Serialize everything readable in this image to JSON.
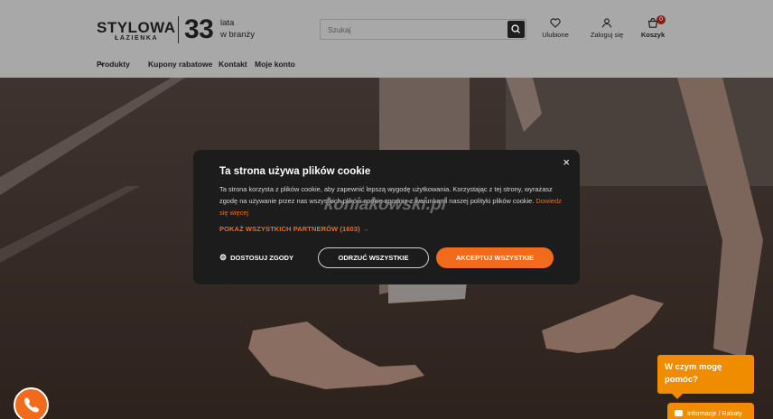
{
  "header": {
    "logo": {
      "brand": "STYLOWA",
      "sub": "ŁAZIENKA",
      "years": "33",
      "years_text_1": "lata",
      "years_text_2": "w branży"
    },
    "search": {
      "placeholder": "Szukaj",
      "icon": "search-icon"
    },
    "icons": {
      "favorites": {
        "label": "Ulubione",
        "icon": "heart-icon"
      },
      "login": {
        "label": "Zaloguj się",
        "icon": "user-icon"
      },
      "cart": {
        "label": "Koszyk",
        "icon": "cart-icon",
        "count": "0"
      }
    },
    "nav": [
      {
        "label": "Produkty",
        "has_dropdown": true
      },
      {
        "label": "Kupony rabatowe"
      },
      {
        "label": "Kontakt"
      },
      {
        "label": "Moje konto"
      }
    ]
  },
  "cookie_modal": {
    "title": "Ta strona używa plików cookie",
    "body": "Ta strona korzysta z plików cookie, aby zapewnić lepszą wygodę użytkowania. Korzystając z tej strony, wyrażasz zgodę na używanie przez nas wszystkich plików cookie zgodnie z warunkami naszej polityki plików cookie.",
    "read_more": "Dowiedz się więcej",
    "partners": "POKAŻ WSZYSTKICH PARTNERÓW (1603) →",
    "customize": "DOSTOSUJ ZGODY",
    "reject": "ODRZUĆ WSZYSTKIE",
    "accept": "AKCEPTUJ WSZYSTKIE",
    "close": "×"
  },
  "watermark": "koniakowski.pl",
  "chat": {
    "bubble": "W czym mogę pomóc?",
    "tab": "Informacje / Rabaty"
  },
  "colors": {
    "accent": "#f26a1b",
    "chat": "#f08c00",
    "modal_bg": "#1c1c1c",
    "header_bg": "#a8a8a8"
  }
}
